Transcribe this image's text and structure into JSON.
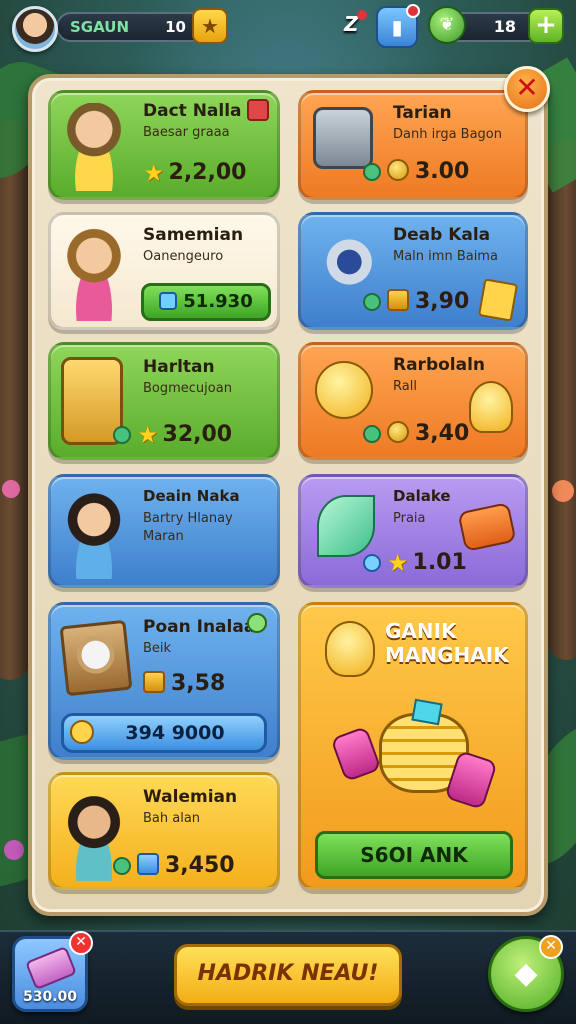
{
  "topbar": {
    "player_name": "SGAUN",
    "player_level": "10",
    "zz_text": "Z",
    "gem_count": "18",
    "plus_label": "+",
    "star_label": "★"
  },
  "panel": {
    "close_label": "✕",
    "cards": [
      {
        "title": "Dact Nalla",
        "sub": "Baesar graaa",
        "price": "2,2,00",
        "currency": "star"
      },
      {
        "title": "Tarian",
        "sub": "Danh irga Bagon",
        "price": "3.00",
        "currency": "coin"
      },
      {
        "title": "Samemian",
        "sub": "Oanengeuro",
        "price": "51.930",
        "currency": "button"
      },
      {
        "title": "Deab Kala",
        "sub": "Maln imn Baima",
        "price": "3,90",
        "currency": "box"
      },
      {
        "title": "Harltan",
        "sub": "Bogmecujoan",
        "price": "32,00",
        "currency": "star"
      },
      {
        "title": "Rarbolaln",
        "sub": "Rall",
        "price": "3,40",
        "currency": "coin"
      },
      {
        "title": "Deain Naka",
        "sub": "Bartry Hlanay",
        "sub2": "Maran",
        "price": "",
        "currency": "none"
      },
      {
        "title": "Dalake",
        "sub": "Praia",
        "price": "1.01",
        "currency": "star"
      },
      {
        "title": "Poan Inalaa",
        "sub": "Beik",
        "price": "3,58",
        "currency": "box",
        "bar_value": "394 9000"
      },
      {
        "title": "Walemian",
        "sub": "Bah alan",
        "price": "3,450",
        "currency": "box"
      }
    ],
    "promo": {
      "title_line1": "GANIK",
      "title_line2": "MANGHAIK",
      "button_label": "S6OI ANK"
    }
  },
  "bottom": {
    "left_value": "530.00",
    "left_close": "✕",
    "hire_label": "HADRIK NEAU!",
    "right_close": "✕"
  },
  "colors": {
    "green_card": "#6cbf3c",
    "orange_card": "#f2862e",
    "blue_card": "#4f8fd8",
    "purple_card": "#9d7ee2",
    "yellow_card": "#ffc83a",
    "panel_bg": "#ebdfc4"
  }
}
